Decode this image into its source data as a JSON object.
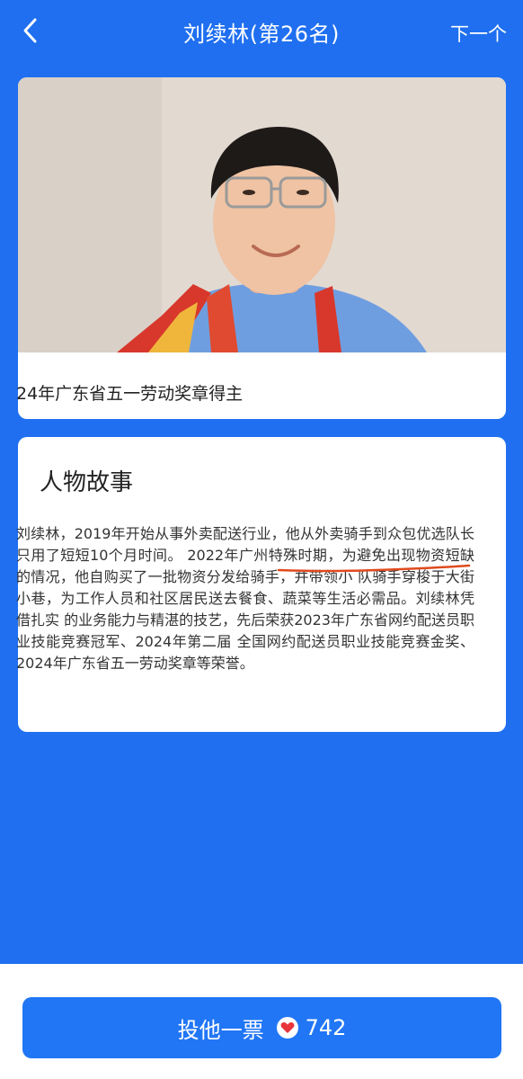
{
  "header": {
    "title": "刘续林(第26名)",
    "next_label": "下一个",
    "back_icon": "chevron-left-icon"
  },
  "profile": {
    "caption": "24年广东省五一劳动奖章得主"
  },
  "story": {
    "title": "人物故事",
    "body": "刘续林，2019年开始从事外卖配送行业，他从外卖骑手到众包优选队长只用了短短10个月时间。 2022年广州特殊时期，为避免出现物资短缺的情况，他自购买了一批物资分发给骑手，并带领小 队骑手穿梭于大街小巷，为工作人员和社区居民送去餐食、蔬菜等生活必需品。刘续林凭借扎实 的业务能力与精湛的技艺，先后荣获2023年广东省网约配送员职业技能竞赛冠军、2024年第二届 全国网约配送员职业技能竞赛金奖、2024年广东省五一劳动奖章等荣誉。"
  },
  "vote": {
    "label": "投他一票",
    "count": "742",
    "icon": "heart-icon"
  },
  "colors": {
    "background": "#1f6ff0",
    "button": "#2176f5",
    "heart": "#e8343a",
    "underline": "#e04a1e"
  }
}
